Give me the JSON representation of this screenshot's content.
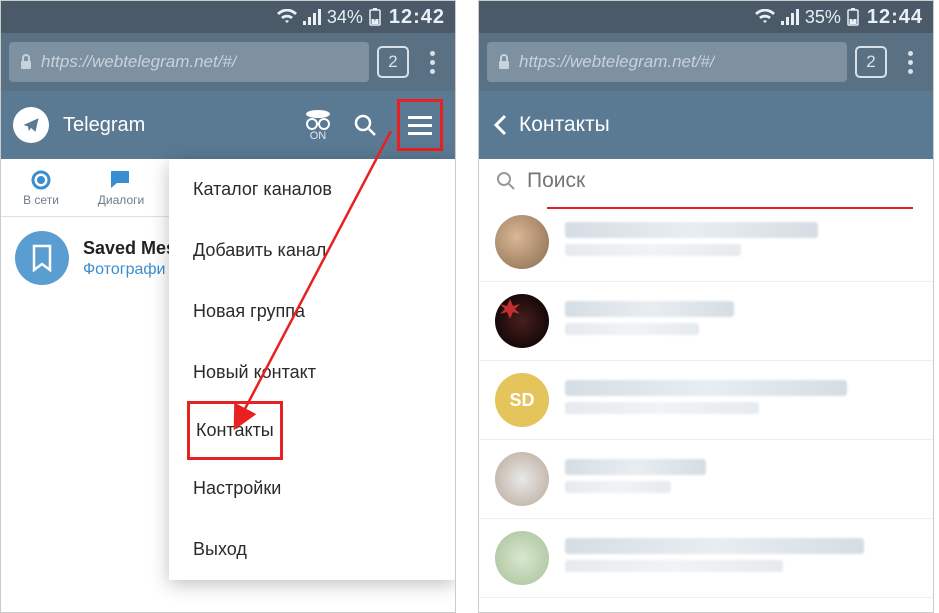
{
  "left": {
    "statusbar": {
      "battery": "34%",
      "time": "12:42"
    },
    "url": "https://webtelegram.net/#/",
    "tabcount": "2",
    "appTitle": "Telegram",
    "incognito": "ON",
    "tabs": {
      "online": "В сети",
      "dialogs": "Диалоги"
    },
    "chat": {
      "name": "Saved Mess",
      "sub": "Фотографи"
    },
    "menu": {
      "catalog": "Каталог каналов",
      "add_channel": "Добавить канал",
      "new_group": "Новая группа",
      "new_contact": "Новый контакт",
      "contacts": "Контакты",
      "settings": "Настройки",
      "logout": "Выход"
    }
  },
  "right": {
    "statusbar": {
      "battery": "35%",
      "time": "12:44"
    },
    "url": "https://webtelegram.net/#/",
    "tabcount": "2",
    "header": "Контакты",
    "search_placeholder": "Поиск",
    "avatar3_initials": "SD"
  }
}
